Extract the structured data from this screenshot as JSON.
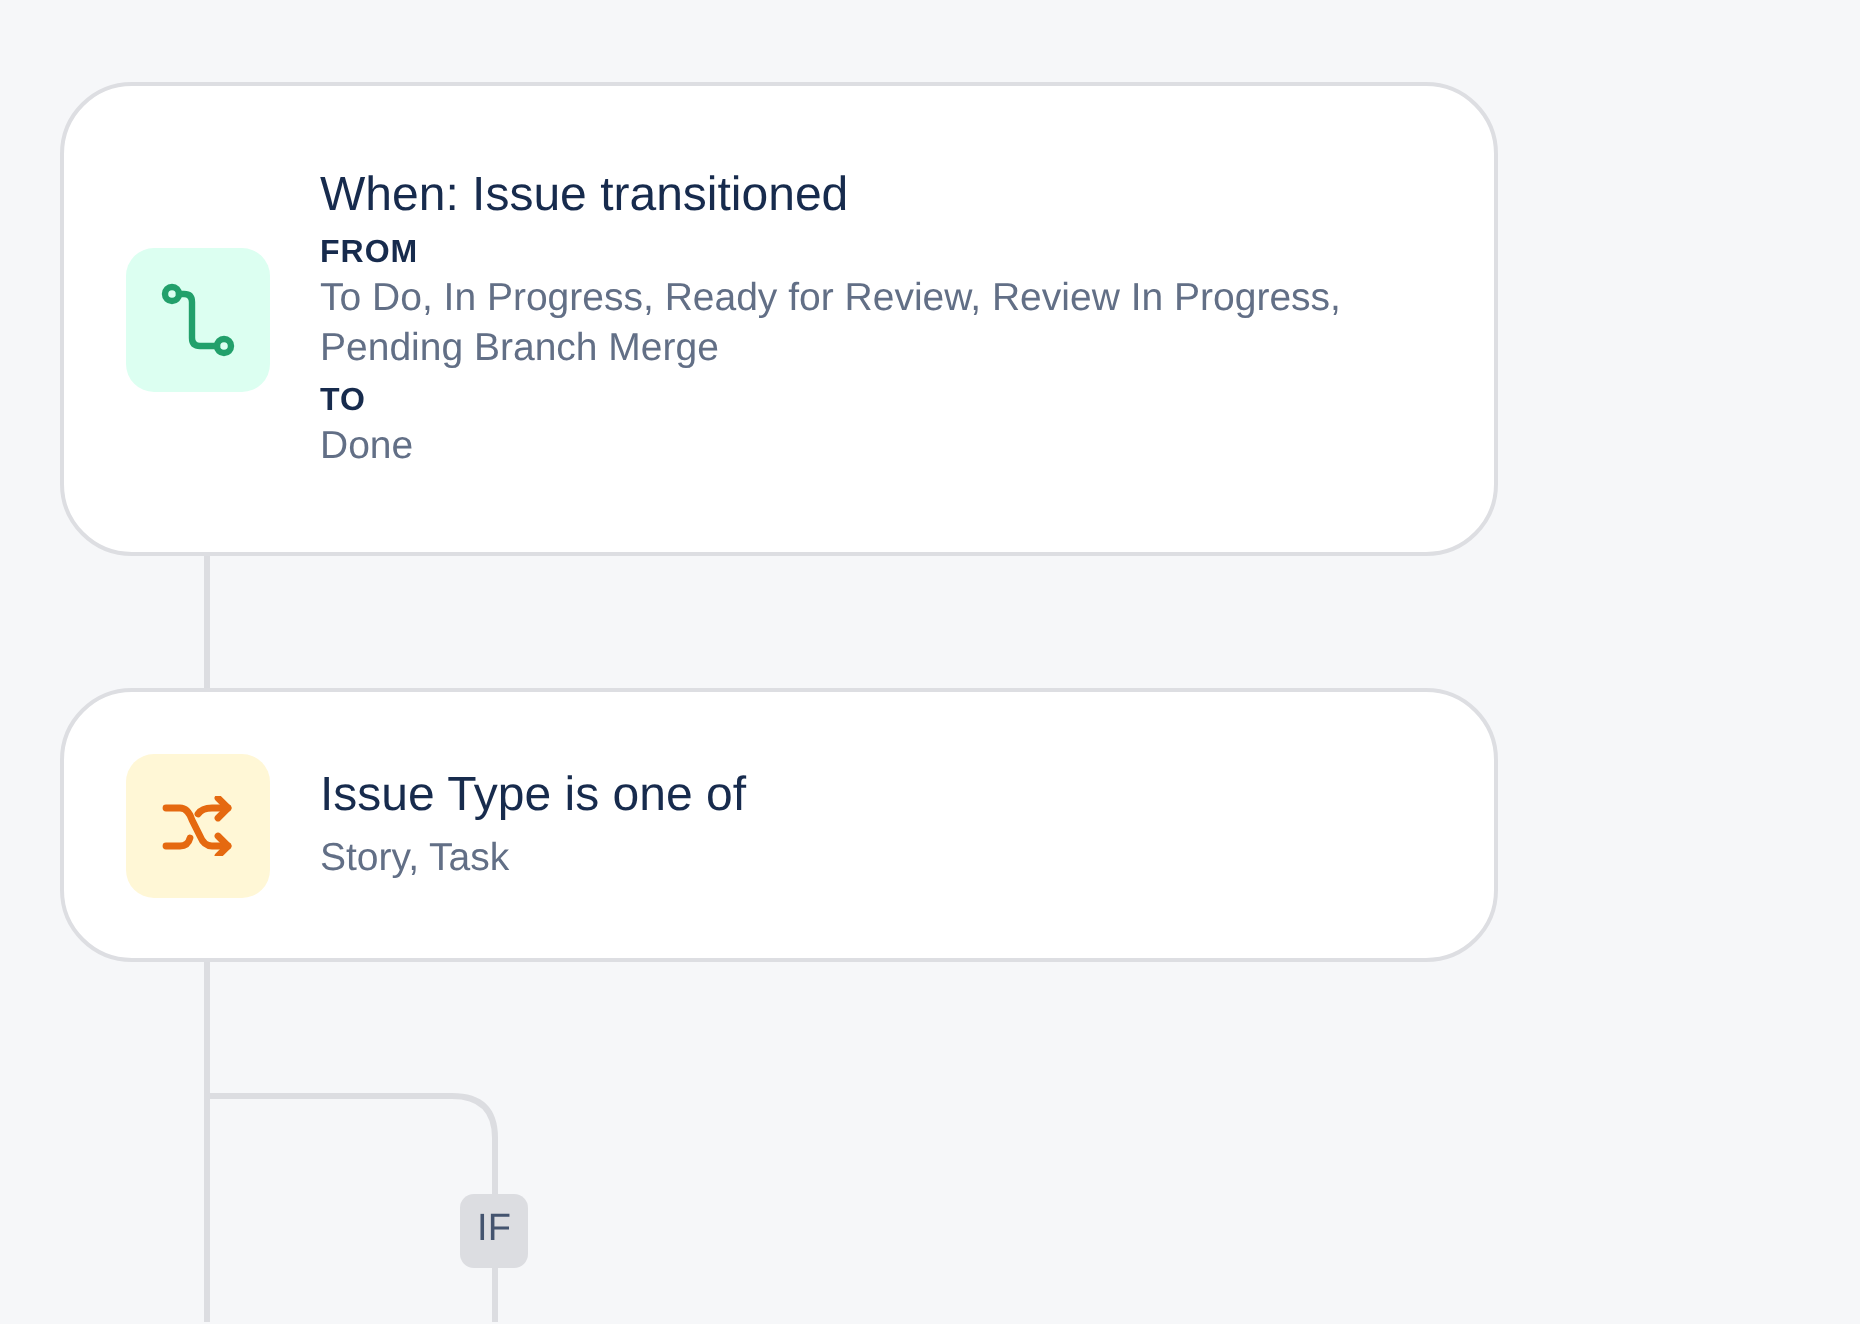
{
  "steps": [
    {
      "kind": "trigger",
      "title": "When: Issue transitioned",
      "details": [
        {
          "label": "FROM",
          "value": "To Do, In Progress, Ready for Review, Review In Progress, Pending Branch Merge"
        },
        {
          "label": "TO",
          "value": "Done"
        }
      ]
    },
    {
      "kind": "condition",
      "title": "Issue Type is one of",
      "details": [
        {
          "value": "Story, Task"
        }
      ]
    }
  ],
  "branch": {
    "label": "IF"
  }
}
